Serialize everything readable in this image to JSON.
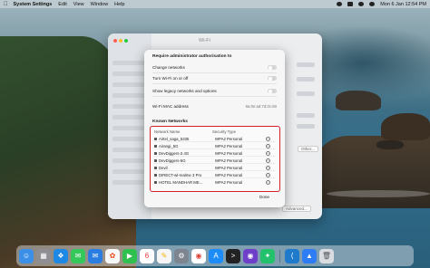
{
  "menubar": {
    "app_name": "System Settings",
    "items": [
      "Edit",
      "View",
      "Window",
      "Help"
    ],
    "clock": "Mon 6 Jan  12:54 PM"
  },
  "settings_window": {
    "title": "Wi-Fi",
    "other_button": "Other...",
    "advanced_button": "Advanced..."
  },
  "sheet": {
    "title": "Require administrator authorisation to",
    "options": [
      {
        "label": "Change networks"
      },
      {
        "label": "Turn Wi-Fi on or off"
      },
      {
        "label": "Show legacy networks and options"
      }
    ],
    "mac_label": "Wi-Fi MAC address",
    "mac_value": "6a:0e:ad:7d:0c:60",
    "known_title": "Known Networks",
    "columns": {
      "name": "Network Name",
      "security": "Security Type"
    },
    "networks": [
      {
        "name": "Airtel_saga_5335",
        "security": "WPA2 Personal"
      },
      {
        "name": "Airangi_5G",
        "security": "WPA2 Personal"
      },
      {
        "name": "DevDiggers-2.4G",
        "security": "WPA2 Personal"
      },
      {
        "name": "DevDiggers-5G",
        "security": "WPA2 Personal"
      },
      {
        "name": "Devil",
        "security": "WPA2 Personal"
      },
      {
        "name": "DIRECT-wl-realme 3 Pro",
        "security": "WPA2 Personal"
      },
      {
        "name": "HOTEL MANDHAR ME...",
        "security": "WPA2 Personal"
      }
    ],
    "done": "Done"
  },
  "colors": {
    "highlight": "#d32026",
    "sheet_bg": "#f6f6f6"
  },
  "dock": {
    "apps": [
      "finder-icon",
      "launchpad-icon",
      "safari-icon",
      "messages-icon",
      "mail-icon",
      "photos-icon",
      "facetime-icon",
      "calendar-icon",
      "notes-icon",
      "system-settings-icon",
      "chrome-icon",
      "app-store-icon",
      "terminal-icon",
      "github-desktop-icon",
      "vscode-icon",
      "appstore-blue-icon",
      "trash-icon"
    ]
  }
}
